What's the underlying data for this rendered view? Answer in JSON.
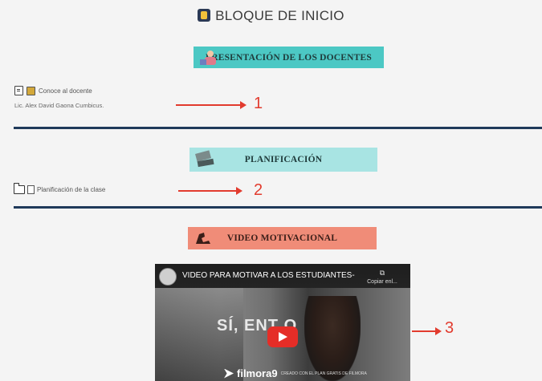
{
  "header": {
    "title": "BLOQUE DE INICIO",
    "icon": "notebook-icon"
  },
  "sections": {
    "presentacion": {
      "label": "PRESENTACIÓN DE LOS DOCENTES",
      "color": "#4cc8c4"
    },
    "planificacion": {
      "label": "PLANIFICACIÓN",
      "color": "#a8e4e3"
    },
    "video": {
      "label": "VIDEO MOTIVACIONAL",
      "color": "#f08c78"
    }
  },
  "links": {
    "conoce": "Conoce al docente",
    "teacher": "Lic. Alex David Gaona Cumbicus.",
    "planificacion": "Planificación de la clase"
  },
  "annotations": [
    "1",
    "2",
    "3"
  ],
  "video": {
    "title": "VIDEO PARA MOTIVAR A LOS ESTUDIANTES-",
    "copy": "Copiar enl...",
    "overlay_text": "SÍ, ENT    O",
    "brand": "filmora9",
    "brand_sub": "CREADO CON EL PLAN GRATIS DE FILMORA"
  },
  "colors": {
    "divider": "#1f3a5a",
    "arrow": "#e23b2e",
    "play": "#e52d27"
  }
}
